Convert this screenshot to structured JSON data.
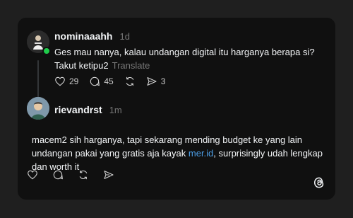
{
  "post": {
    "username": "nominaaahh",
    "time": "1d",
    "text": "Ges mau nanya, kalau undangan digital itu harganya berapa si? Takut ketipu2",
    "translate_label": "Translate",
    "likes": "29",
    "comments": "45",
    "shares": "3"
  },
  "reply": {
    "username": "rievandrst",
    "time": "1m",
    "text_before_link": "macem2 sih harganya, tapi sekarang mending budget ke yang lain undangan pakai yang gratis aja kayak ",
    "link_text": "mer.id",
    "text_after_link": ", surprisingly udah lengkap dan worth it"
  },
  "icons": {
    "like": "heart-icon",
    "comment": "comment-icon",
    "repost": "repost-icon",
    "share": "send-icon",
    "brand": "threads-logo-icon"
  },
  "colors": {
    "page_bg": "#1f1f1f",
    "card_bg": "#101010",
    "link": "#4c9fe8",
    "online": "#1fcc4b",
    "muted": "#777777"
  }
}
